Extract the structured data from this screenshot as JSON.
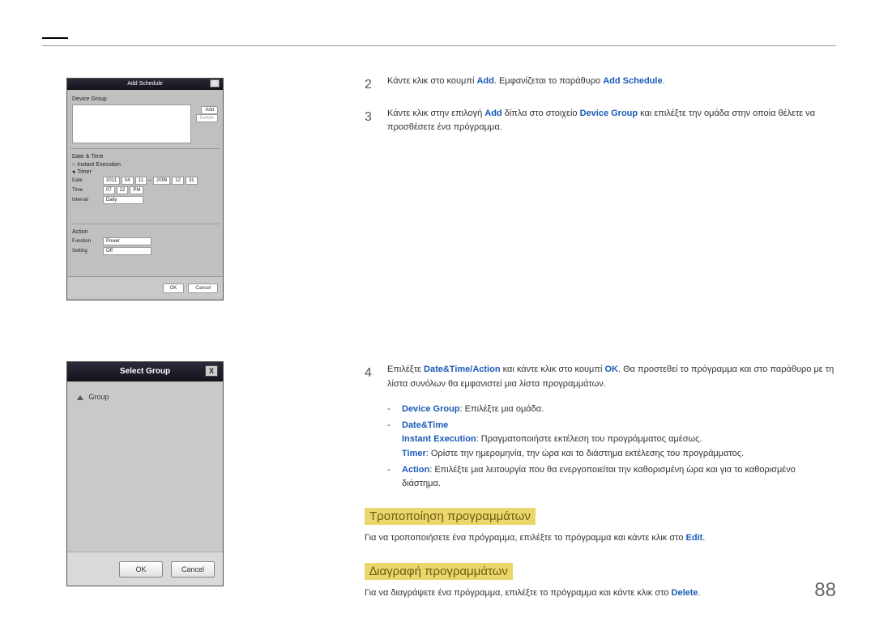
{
  "page_number": "88",
  "shot1": {
    "title": "Add Schedule",
    "device_group": "Device Group",
    "add": "Add",
    "delete": "Delete",
    "date_time": "Date & Time",
    "instant_exec": "Instant Execution",
    "timer": "Timer",
    "date_label": "Date",
    "date_y1": "2011",
    "date_m1": "04",
    "date_d1": "11",
    "date_y2": "2099",
    "date_m2": "12",
    "date_d2": "31",
    "time_label": "Time",
    "time_h": "07",
    "time_m": "22",
    "time_ampm": "PM",
    "interval_label": "Interval",
    "interval_val": "Daily",
    "action": "Action",
    "function": "Function",
    "function_val": "Power",
    "setting": "Setting",
    "setting_val": "Off",
    "ok": "OK",
    "cancel": "Cancel"
  },
  "shot2": {
    "title": "Select Group",
    "group": "Group",
    "ok": "OK",
    "cancel": "Cancel"
  },
  "step2": {
    "pre": "Κάντε κλικ στο κουμπί ",
    "add": "Add",
    "mid": ". Εμφανίζεται το παράθυρο ",
    "add_schedule": "Add Schedule",
    "post": "."
  },
  "step3": {
    "pre": "Κάντε κλικ στην επιλογή ",
    "add": "Add",
    "mid": " δίπλα στο στοιχείο ",
    "dg": "Device Group",
    "post": " και επιλέξτε την ομάδα στην οποία θέλετε να προσθέσετε ένα πρόγραμμα."
  },
  "step4": {
    "pre": "Επιλέξτε ",
    "dta": "Date&Time/Action",
    "mid": " και κάντε κλικ στο κουμπί ",
    "ok": "OK",
    "post": ". Θα προστεθεί το πρόγραμμα και στο παράθυρο με τη λίστα συνόλων θα εμφανιστεί μια λίστα προγραμμάτων.",
    "li1a": "Device Group",
    "li1b": ": Επιλέξτε μια ομάδα.",
    "li2a": "Date&Time",
    "li2b_a": "Instant Execution",
    "li2b_b": ": Πραγματοποιήστε εκτέλεση του προγράμματος αμέσως.",
    "li2c_a": "Timer",
    "li2c_b": ": Ορίστε την ημερομηνία, την ώρα και το διάστημα εκτέλεσης του προγράμματος.",
    "li3a": "Action",
    "li3b": ": Επιλέξτε μια λειτουργία που θα ενεργοποιείται την καθορισμένη ώρα και για το καθορισμένο διάστημα."
  },
  "sec_modify": {
    "title": "Τροποποίηση προγραμμάτων",
    "text_a": "Για να τροποποιήσετε ένα πρόγραμμα, επιλέξτε το πρόγραμμα και κάντε κλικ στο ",
    "edit": "Edit",
    "text_b": "."
  },
  "sec_delete": {
    "title": "∆ιαγραφή προγραμμάτων",
    "text_a": "Για να διαγράψετε ένα πρόγραμμα, επιλέξτε το πρόγραμμα και κάντε κλικ στο ",
    "del": "Delete",
    "text_b": "."
  }
}
